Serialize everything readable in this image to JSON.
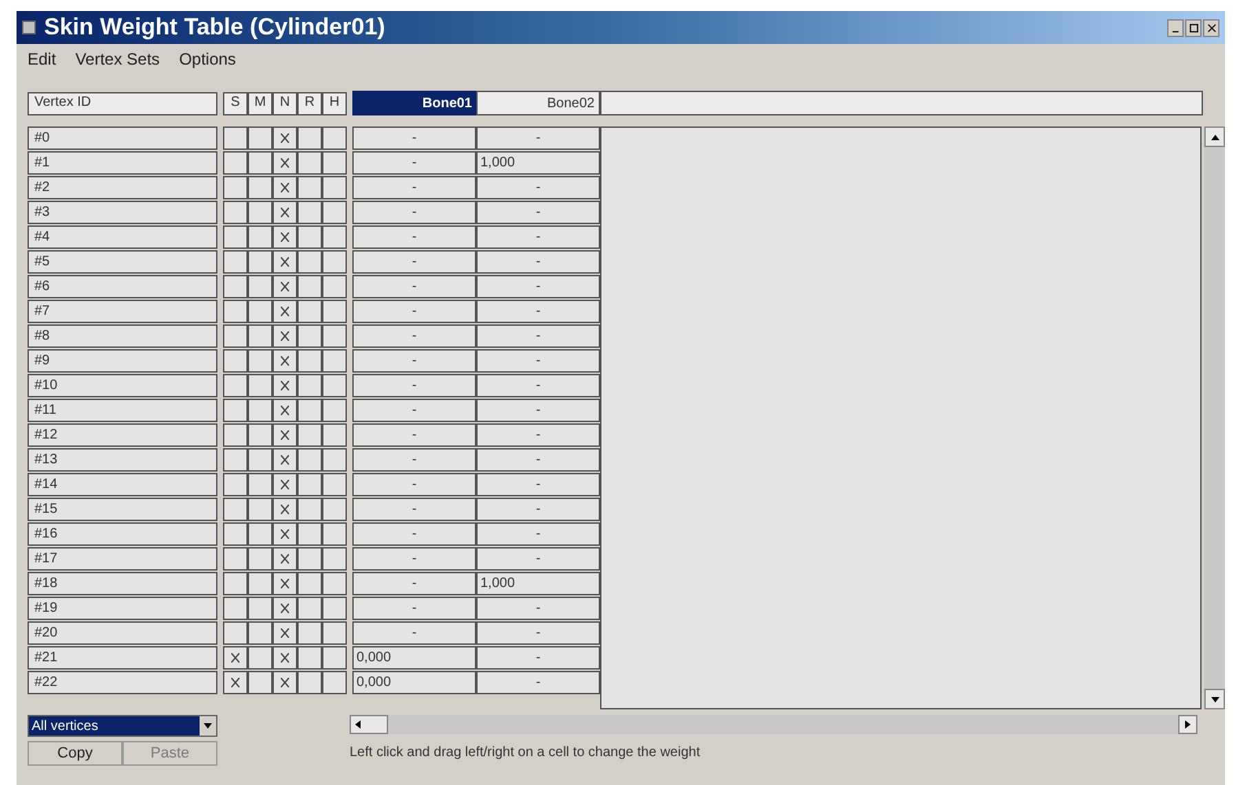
{
  "window": {
    "title": "Skin Weight Table (Cylinder01)"
  },
  "menu": [
    "Edit",
    "Vertex Sets",
    "Options"
  ],
  "header": {
    "vertex_id": "Vertex ID",
    "flags": [
      "S",
      "M",
      "N",
      "R",
      "H"
    ],
    "bones": [
      {
        "label": "Bone01",
        "selected": true
      },
      {
        "label": "Bone02",
        "selected": false
      }
    ]
  },
  "rows": [
    {
      "id": "#0",
      "flags": [
        false,
        false,
        true,
        false,
        false
      ],
      "weights": [
        {
          "kind": "none",
          "text": "-"
        },
        {
          "kind": "none",
          "text": "-"
        }
      ]
    },
    {
      "id": "#1",
      "flags": [
        false,
        false,
        true,
        false,
        false
      ],
      "weights": [
        {
          "kind": "none",
          "text": "-"
        },
        {
          "kind": "value",
          "text": "1,000"
        }
      ]
    },
    {
      "id": "#2",
      "flags": [
        false,
        false,
        true,
        false,
        false
      ],
      "weights": [
        {
          "kind": "none",
          "text": "-"
        },
        {
          "kind": "none",
          "text": "-"
        }
      ]
    },
    {
      "id": "#3",
      "flags": [
        false,
        false,
        true,
        false,
        false
      ],
      "weights": [
        {
          "kind": "none",
          "text": "-"
        },
        {
          "kind": "none",
          "text": "-"
        }
      ]
    },
    {
      "id": "#4",
      "flags": [
        false,
        false,
        true,
        false,
        false
      ],
      "weights": [
        {
          "kind": "none",
          "text": "-"
        },
        {
          "kind": "none",
          "text": "-"
        }
      ]
    },
    {
      "id": "#5",
      "flags": [
        false,
        false,
        true,
        false,
        false
      ],
      "weights": [
        {
          "kind": "none",
          "text": "-"
        },
        {
          "kind": "none",
          "text": "-"
        }
      ]
    },
    {
      "id": "#6",
      "flags": [
        false,
        false,
        true,
        false,
        false
      ],
      "weights": [
        {
          "kind": "none",
          "text": "-"
        },
        {
          "kind": "none",
          "text": "-"
        }
      ]
    },
    {
      "id": "#7",
      "flags": [
        false,
        false,
        true,
        false,
        false
      ],
      "weights": [
        {
          "kind": "none",
          "text": "-"
        },
        {
          "kind": "none",
          "text": "-"
        }
      ]
    },
    {
      "id": "#8",
      "flags": [
        false,
        false,
        true,
        false,
        false
      ],
      "weights": [
        {
          "kind": "none",
          "text": "-"
        },
        {
          "kind": "none",
          "text": "-"
        }
      ]
    },
    {
      "id": "#9",
      "flags": [
        false,
        false,
        true,
        false,
        false
      ],
      "weights": [
        {
          "kind": "none",
          "text": "-"
        },
        {
          "kind": "none",
          "text": "-"
        }
      ]
    },
    {
      "id": "#10",
      "flags": [
        false,
        false,
        true,
        false,
        false
      ],
      "weights": [
        {
          "kind": "none",
          "text": "-"
        },
        {
          "kind": "none",
          "text": "-"
        }
      ]
    },
    {
      "id": "#11",
      "flags": [
        false,
        false,
        true,
        false,
        false
      ],
      "weights": [
        {
          "kind": "none",
          "text": "-"
        },
        {
          "kind": "none",
          "text": "-"
        }
      ]
    },
    {
      "id": "#12",
      "flags": [
        false,
        false,
        true,
        false,
        false
      ],
      "weights": [
        {
          "kind": "none",
          "text": "-"
        },
        {
          "kind": "none",
          "text": "-"
        }
      ]
    },
    {
      "id": "#13",
      "flags": [
        false,
        false,
        true,
        false,
        false
      ],
      "weights": [
        {
          "kind": "none",
          "text": "-"
        },
        {
          "kind": "none",
          "text": "-"
        }
      ]
    },
    {
      "id": "#14",
      "flags": [
        false,
        false,
        true,
        false,
        false
      ],
      "weights": [
        {
          "kind": "none",
          "text": "-"
        },
        {
          "kind": "none",
          "text": "-"
        }
      ]
    },
    {
      "id": "#15",
      "flags": [
        false,
        false,
        true,
        false,
        false
      ],
      "weights": [
        {
          "kind": "none",
          "text": "-"
        },
        {
          "kind": "none",
          "text": "-"
        }
      ]
    },
    {
      "id": "#16",
      "flags": [
        false,
        false,
        true,
        false,
        false
      ],
      "weights": [
        {
          "kind": "none",
          "text": "-"
        },
        {
          "kind": "none",
          "text": "-"
        }
      ]
    },
    {
      "id": "#17",
      "flags": [
        false,
        false,
        true,
        false,
        false
      ],
      "weights": [
        {
          "kind": "none",
          "text": "-"
        },
        {
          "kind": "none",
          "text": "-"
        }
      ]
    },
    {
      "id": "#18",
      "flags": [
        false,
        false,
        true,
        false,
        false
      ],
      "weights": [
        {
          "kind": "none",
          "text": "-"
        },
        {
          "kind": "value",
          "text": "1,000"
        }
      ]
    },
    {
      "id": "#19",
      "flags": [
        false,
        false,
        true,
        false,
        false
      ],
      "weights": [
        {
          "kind": "none",
          "text": "-"
        },
        {
          "kind": "none",
          "text": "-"
        }
      ]
    },
    {
      "id": "#20",
      "flags": [
        false,
        false,
        true,
        false,
        false
      ],
      "weights": [
        {
          "kind": "none",
          "text": "-"
        },
        {
          "kind": "none",
          "text": "-"
        }
      ]
    },
    {
      "id": "#21",
      "flags": [
        true,
        false,
        true,
        false,
        false
      ],
      "weights": [
        {
          "kind": "value",
          "text": "0,000"
        },
        {
          "kind": "none",
          "text": "-"
        }
      ]
    },
    {
      "id": "#22",
      "flags": [
        true,
        false,
        true,
        false,
        false
      ],
      "weights": [
        {
          "kind": "value",
          "text": "0,000"
        },
        {
          "kind": "none",
          "text": "-"
        }
      ]
    }
  ],
  "vertex_set": {
    "value": "All vertices"
  },
  "buttons": [
    {
      "label": "Copy",
      "disabled": false
    },
    {
      "label": "Paste",
      "disabled": true
    }
  ],
  "status": "Left click and drag left/right on a cell to change the weight"
}
